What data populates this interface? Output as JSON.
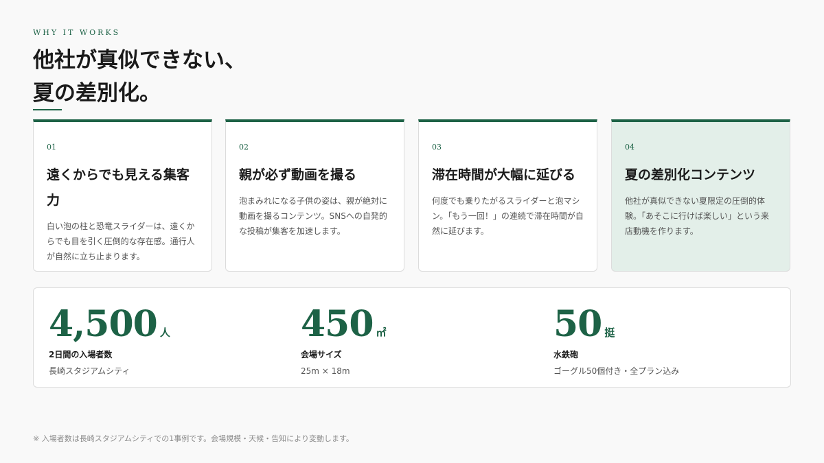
{
  "eyebrow": "WHY IT WORKS",
  "headline": {
    "line1": "他社が真似できない、",
    "line2": "夏の差別化。"
  },
  "cards": [
    {
      "number": "01",
      "title": "遠くからでも見える集客力",
      "description": "白い泡の柱と恐竜スライダーは、遠くからでも目を引く圧倒的な存在感。通行人が自然に立ち止まります。"
    },
    {
      "number": "02",
      "title": "親が必ず動画を撮る",
      "description": "泡まみれになる子供の姿は、親が絶対に動画を撮るコンテンツ。SNSへの自発的な投稿が集客を加速します。"
    },
    {
      "number": "03",
      "title": "滞在時間が大幅に延びる",
      "description": "何度でも乗りたがるスライダーと泡マシン。「もう一回！」の連続で滞在時間が自然に延びます。"
    },
    {
      "number": "04",
      "title": "夏の差別化コンテンツ",
      "description": "他社が真似できない夏限定の圧倒的体験。「あそこに行けば楽しい」という来店動機を作ります。"
    }
  ],
  "stats": [
    {
      "value": "4,500",
      "unit": "人",
      "label": "2日間の入場者数",
      "sub": "長崎スタジアムシティ"
    },
    {
      "value": "450",
      "unit": "㎡",
      "label": "会場サイズ",
      "sub": "25m × 18m"
    },
    {
      "value": "50",
      "unit": "挺",
      "label": "水鉄砲",
      "sub": "ゴーグル50個付き・全プラン込み"
    }
  ],
  "footnote": "※ 入場者数は長崎スタジアムシティでの1事例です。会場規模・天候・告知により変動します。",
  "colors": {
    "accent": "#1d6246",
    "highlight_card": "#e3efe9",
    "background": "#f9f9f9"
  }
}
